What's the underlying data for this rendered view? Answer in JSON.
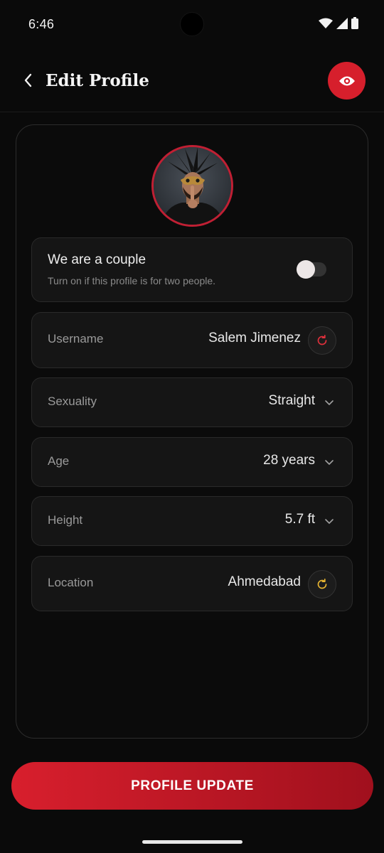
{
  "status_bar": {
    "time": "6:46"
  },
  "header": {
    "title": "Edit Profile",
    "back_icon": "chevron-left-icon",
    "preview_icon": "eye-icon"
  },
  "profile": {
    "avatar_alt": "profile-photo",
    "couple": {
      "title": "We are a couple",
      "subtitle": "Turn on if this profile is for two people.",
      "enabled": false
    },
    "fields": {
      "username": {
        "label": "Username",
        "value": "Salem Jimenez"
      },
      "sexuality": {
        "label": "Sexuality",
        "value": "Straight"
      },
      "age": {
        "label": "Age",
        "value": "28 years"
      },
      "height": {
        "label": "Height",
        "value": "5.7 ft"
      },
      "location": {
        "label": "Location",
        "value": "Ahmedabad"
      }
    }
  },
  "actions": {
    "update_label": "PROFILE UPDATE"
  },
  "colors": {
    "accent": "#d61f2c",
    "refresh_red": "#e0303c",
    "refresh_gold": "#e7b431",
    "card_bg": "#151515"
  }
}
